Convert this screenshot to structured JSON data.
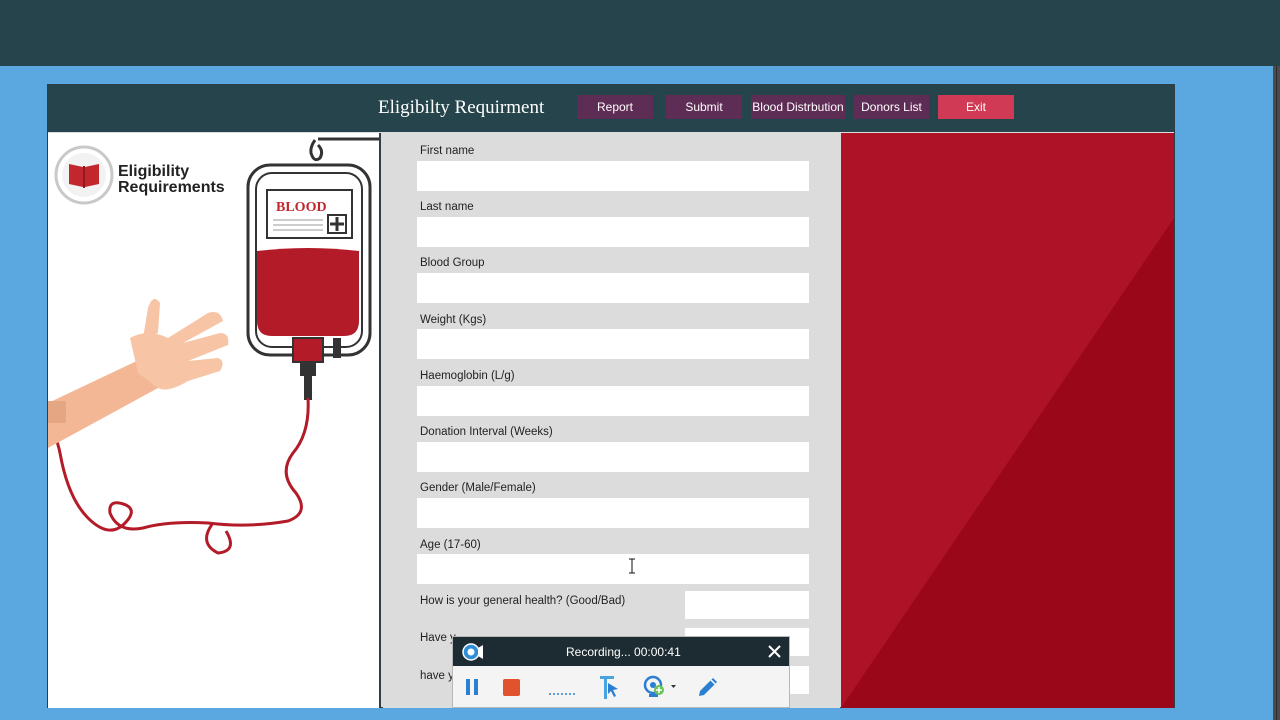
{
  "app": {
    "title": "Eligibilty Requirment"
  },
  "nav": {
    "report": "Report",
    "submit": "Submit",
    "blood_distribution": "Blood Distrbution",
    "donors_list": "Donors List",
    "exit": "Exit"
  },
  "illustration": {
    "heading_line1": "Eligibility",
    "heading_line2": "Requirements",
    "bag_label": "BLOOD"
  },
  "form": {
    "fields": [
      {
        "label": "First name",
        "value": ""
      },
      {
        "label": "Last name",
        "value": ""
      },
      {
        "label": "Blood Group",
        "value": ""
      },
      {
        "label": "Weight (Kgs)",
        "value": ""
      },
      {
        "label": "Haemoglobin (L/g)",
        "value": ""
      },
      {
        "label": "Donation Interval (Weeks)",
        "value": ""
      },
      {
        "label": "Gender (Male/Female)",
        "value": ""
      },
      {
        "label": "Age (17-60)",
        "value": ""
      }
    ],
    "questions": [
      {
        "label": "How is your general health? (Good/Bad)",
        "value": ""
      },
      {
        "label": "Have y",
        "value": ""
      },
      {
        "label": "have y",
        "value": ""
      }
    ]
  },
  "recorder": {
    "status": "Recording... 00:00:41",
    "icons": [
      "recorder-logo-icon",
      "pause-icon",
      "stop-icon",
      "dotted-line-icon",
      "cursor-tool-icon",
      "webcam-add-icon",
      "pen-icon",
      "close-icon"
    ]
  },
  "colors": {
    "header": "#26444b",
    "button": "#5e2d55",
    "exit_button": "#d13a55",
    "red_panel": "#ab1023",
    "background": "#5ba7e0"
  }
}
